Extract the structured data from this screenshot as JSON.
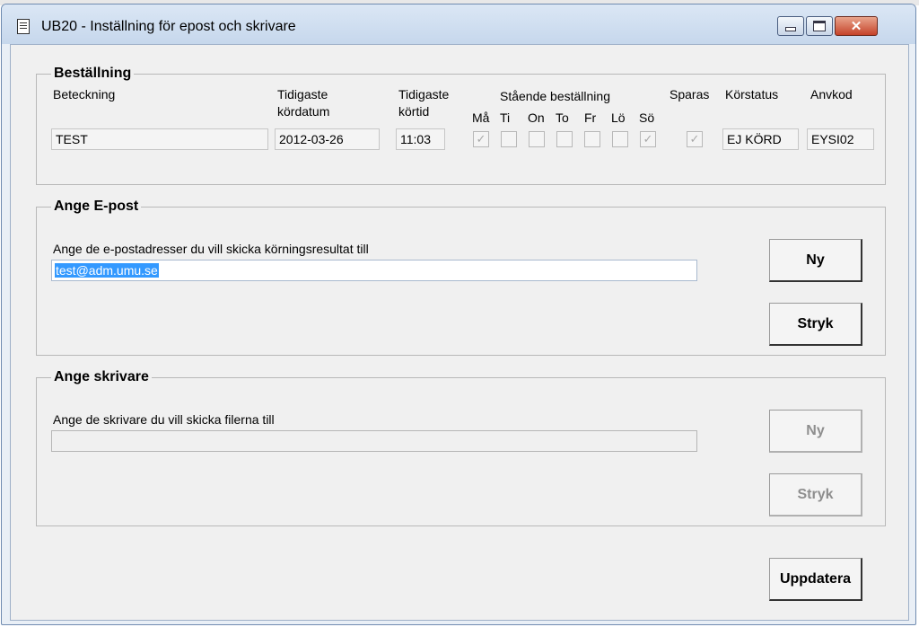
{
  "window": {
    "title": "UB20 - Inställning för epost och skrivare",
    "close_glyph": "✕"
  },
  "order": {
    "legend": "Beställning",
    "headers": {
      "designation": "Beteckning",
      "earliest_date_l1": "Tidigaste",
      "earliest_date_l2": "kördatum",
      "earliest_time_l1": "Tidigaste",
      "earliest_time_l2": "körtid",
      "standing": "Stående beställning",
      "save": "Sparas",
      "run_status": "Körstatus",
      "user_code": "Anvkod"
    },
    "days": [
      {
        "label": "Må",
        "checked": true
      },
      {
        "label": "Ti",
        "checked": false
      },
      {
        "label": "On",
        "checked": false
      },
      {
        "label": "To",
        "checked": false
      },
      {
        "label": "Fr",
        "checked": false
      },
      {
        "label": "Lö",
        "checked": false
      },
      {
        "label": "Sö",
        "checked": true
      }
    ],
    "values": {
      "designation": "TEST",
      "earliest_date": "2012-03-26",
      "earliest_time": "11:03",
      "save_checked": true,
      "run_status": "EJ KÖRD",
      "user_code": "EYSI02"
    }
  },
  "email": {
    "legend": "Ange E-post",
    "instruction": "Ange de e-postadresser du vill skicka körningsresultat till",
    "address": "test@adm.umu.se",
    "new_label": "Ny",
    "delete_label": "Stryk"
  },
  "printer": {
    "legend": "Ange skrivare",
    "instruction": "Ange de skrivare du vill skicka filerna till",
    "value": "",
    "new_label": "Ny",
    "delete_label": "Stryk"
  },
  "update_label": "Uppdatera",
  "check_glyph": "✓"
}
